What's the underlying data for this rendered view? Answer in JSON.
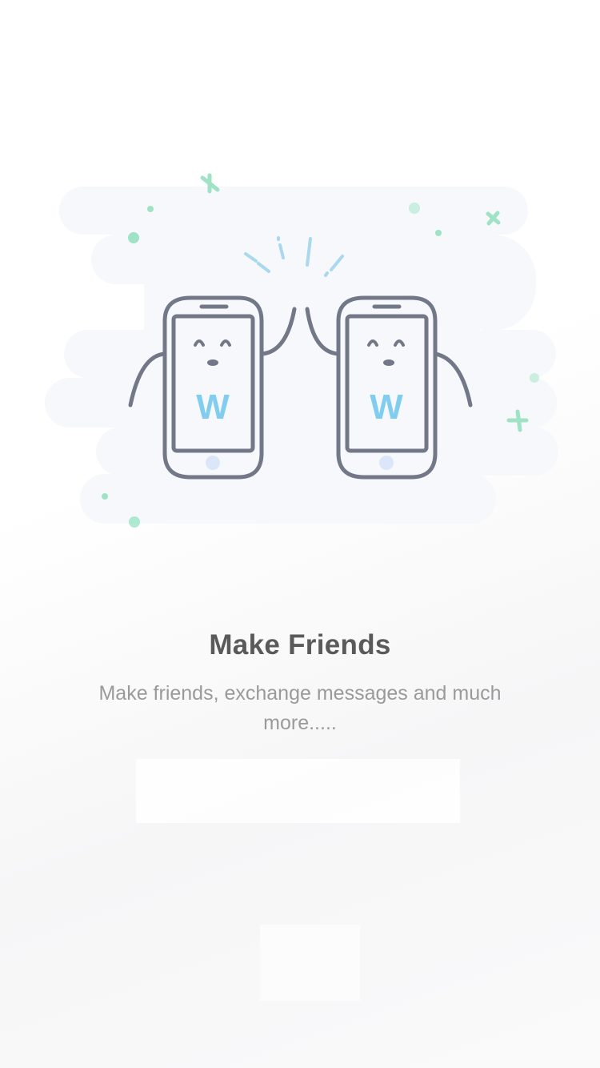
{
  "onboarding": {
    "title": "Make Friends",
    "subtitle": "Make friends, exchange messages and much more.....",
    "illustration": {
      "icon": "high-five-phones-icon",
      "phone_letter": "W",
      "colors": {
        "cloud": "#f6f8fb",
        "outline": "#727887",
        "letter": "#80cdf0",
        "sparkle": "#9ee3c6",
        "burst": "#a9d8ef"
      }
    }
  }
}
